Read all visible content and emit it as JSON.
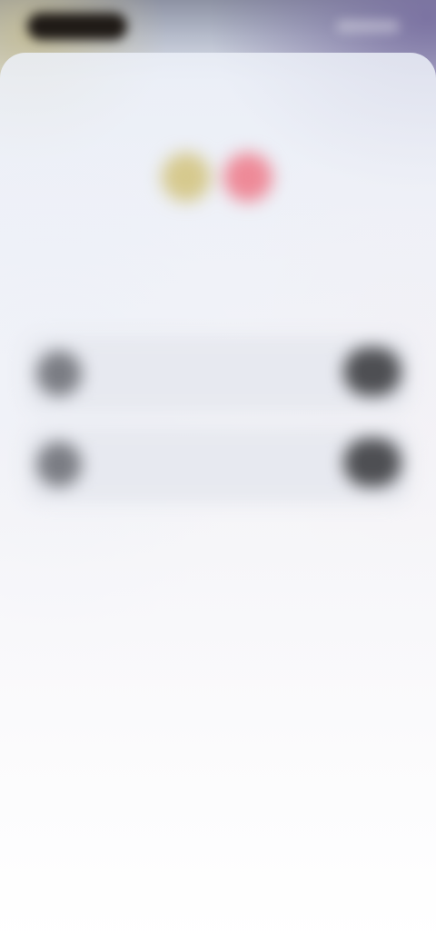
{
  "status_bar": {
    "time": "",
    "indicators": ""
  },
  "sheet": {
    "logos": [
      "app-logo-yellow",
      "app-logo-pink"
    ],
    "subtitle_top": "",
    "title": "",
    "subtitle": "",
    "options": [
      {
        "icon": "option-icon",
        "title": "",
        "description": "",
        "button_label": ""
      },
      {
        "icon": "option-icon",
        "title": "",
        "description": "",
        "button_label": ""
      }
    ],
    "footer_link": ""
  },
  "colors": {
    "logo_yellow": "#d6c98e",
    "logo_pink": "#ee8a98",
    "button": "#4e4f53",
    "card_background": "#e6e8ee"
  }
}
